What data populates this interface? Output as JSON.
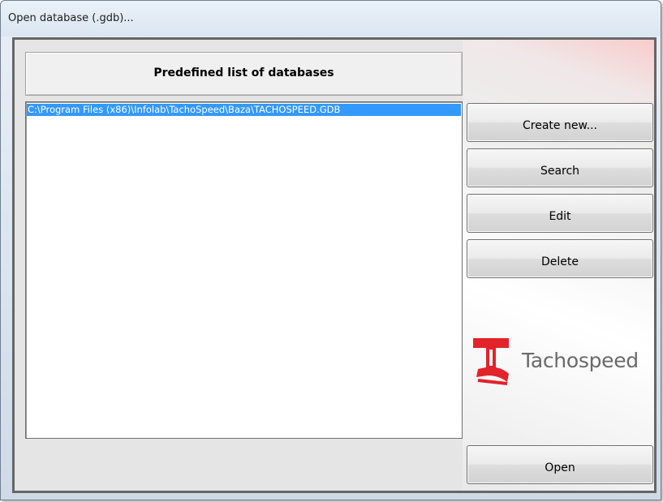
{
  "window": {
    "title": "Open database (.gdb)..."
  },
  "header": {
    "title": "Predefined list of databases"
  },
  "database_list": {
    "items": [
      "C:\\Program Files (x86)\\Infolab\\TachoSpeed\\Baza\\TACHOSPEED.GDB"
    ],
    "selected_index": 0
  },
  "buttons": {
    "create_new": "Create new...",
    "search": "Search",
    "edit": "Edit",
    "delete": "Delete",
    "open": "Open"
  },
  "logo": {
    "text": "Tachospeed",
    "color": "#e2232a"
  },
  "colors": {
    "selection": "#3399ff",
    "logo_red": "#e2232a"
  }
}
